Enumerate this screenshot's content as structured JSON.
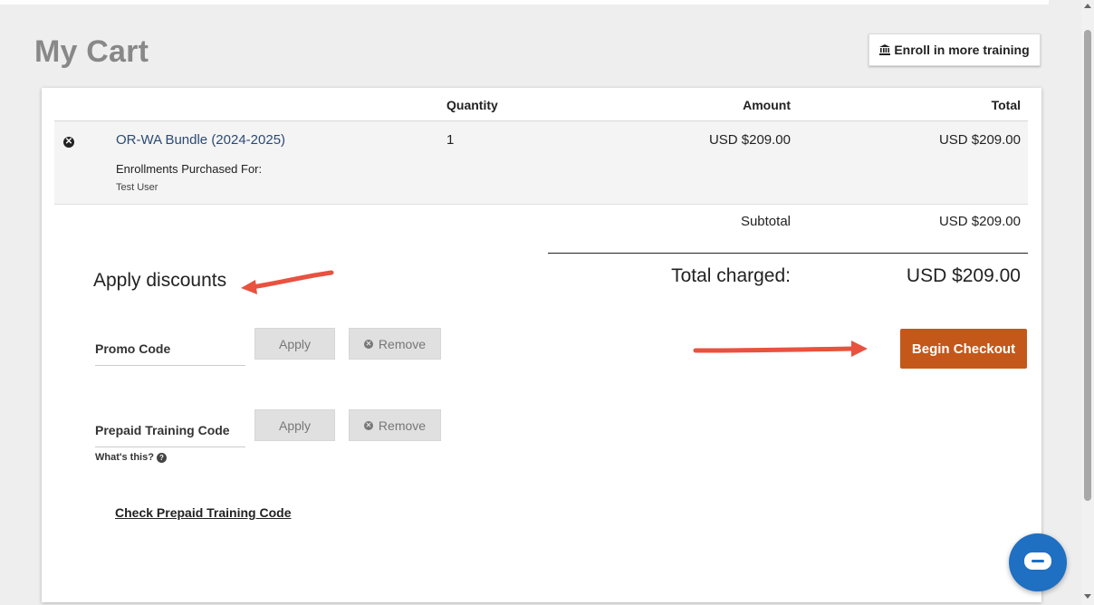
{
  "page": {
    "title": "My Cart"
  },
  "header": {
    "enroll_label": "Enroll in more training",
    "enroll_icon": "institution-icon"
  },
  "cart": {
    "columns": {
      "quantity": "Quantity",
      "amount": "Amount",
      "total": "Total"
    },
    "items": [
      {
        "name": "OR-WA Bundle (2024-2025)",
        "quantity": "1",
        "amount": "USD $209.00",
        "total": "USD $209.00",
        "purchased_for_label": "Enrollments Purchased For:",
        "purchased_for": "Test User"
      }
    ],
    "subtotal_label": "Subtotal",
    "subtotal_value": "USD $209.00",
    "total_label": "Total charged:",
    "total_value": "USD $209.00"
  },
  "discounts": {
    "title": "Apply discounts",
    "promo": {
      "label": "Promo Code",
      "apply": "Apply",
      "remove": "Remove"
    },
    "prepaid": {
      "label": "Prepaid Training Code",
      "apply": "Apply",
      "remove": "Remove",
      "help": "What's this?"
    },
    "check_link": "Check Prepaid Training Code"
  },
  "checkout": {
    "label": "Begin Checkout"
  },
  "colors": {
    "checkout": "#c4581a",
    "link": "#2b4a73",
    "annotation_arrow": "#e8523f",
    "chat": "#1f6fc2"
  }
}
